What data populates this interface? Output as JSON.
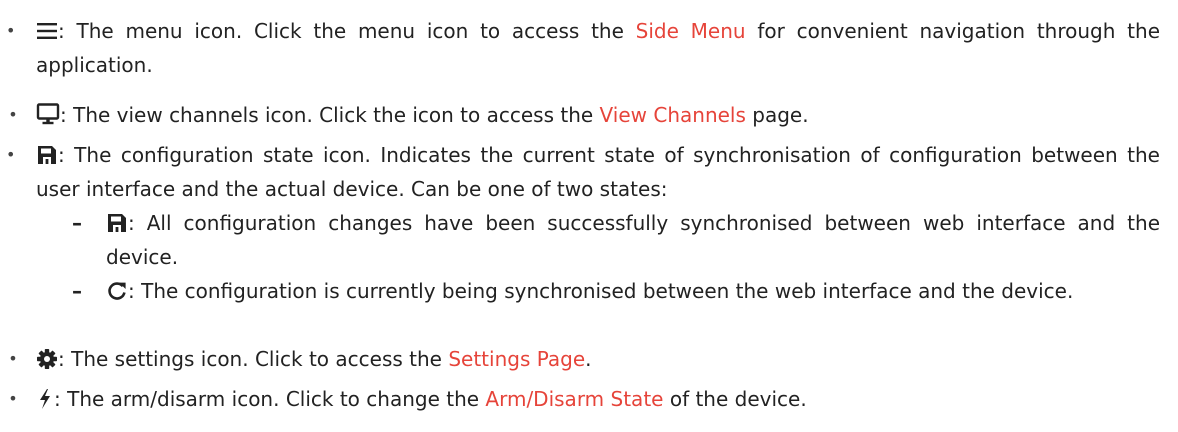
{
  "colors": {
    "text": "#222222",
    "link": "#e6443a"
  },
  "items": [
    {
      "icon": "menu-icon",
      "before": ": The menu icon.  Click the menu icon to access the ",
      "link": "Side Menu",
      "after": " for convenient navigation through the application."
    },
    {
      "icon": "monitor-icon",
      "before": ": The view channels icon. Click the icon to access the ",
      "link": "View Channels",
      "after": " page."
    },
    {
      "icon": "save-icon",
      "before": ": The configuration state icon. Indicates the current state of synchronisation of configuration between the user interface and the actual device. Can be one of two states:",
      "sub_items": [
        {
          "icon": "save-icon",
          "text": ": All configuration changes have been successfully synchronised between web interface and the device."
        },
        {
          "icon": "refresh-icon",
          "text": ": The configuration is currently being synchronised between the web interface and the device."
        }
      ]
    },
    {
      "icon": "gear-icon",
      "before": ": The settings icon. Click to access the ",
      "link": "Settings Page",
      "after": "."
    },
    {
      "icon": "bolt-icon",
      "before": ": The arm/disarm icon. Click to change the ",
      "link": "Arm/Disarm State",
      "after": " of the device."
    }
  ]
}
